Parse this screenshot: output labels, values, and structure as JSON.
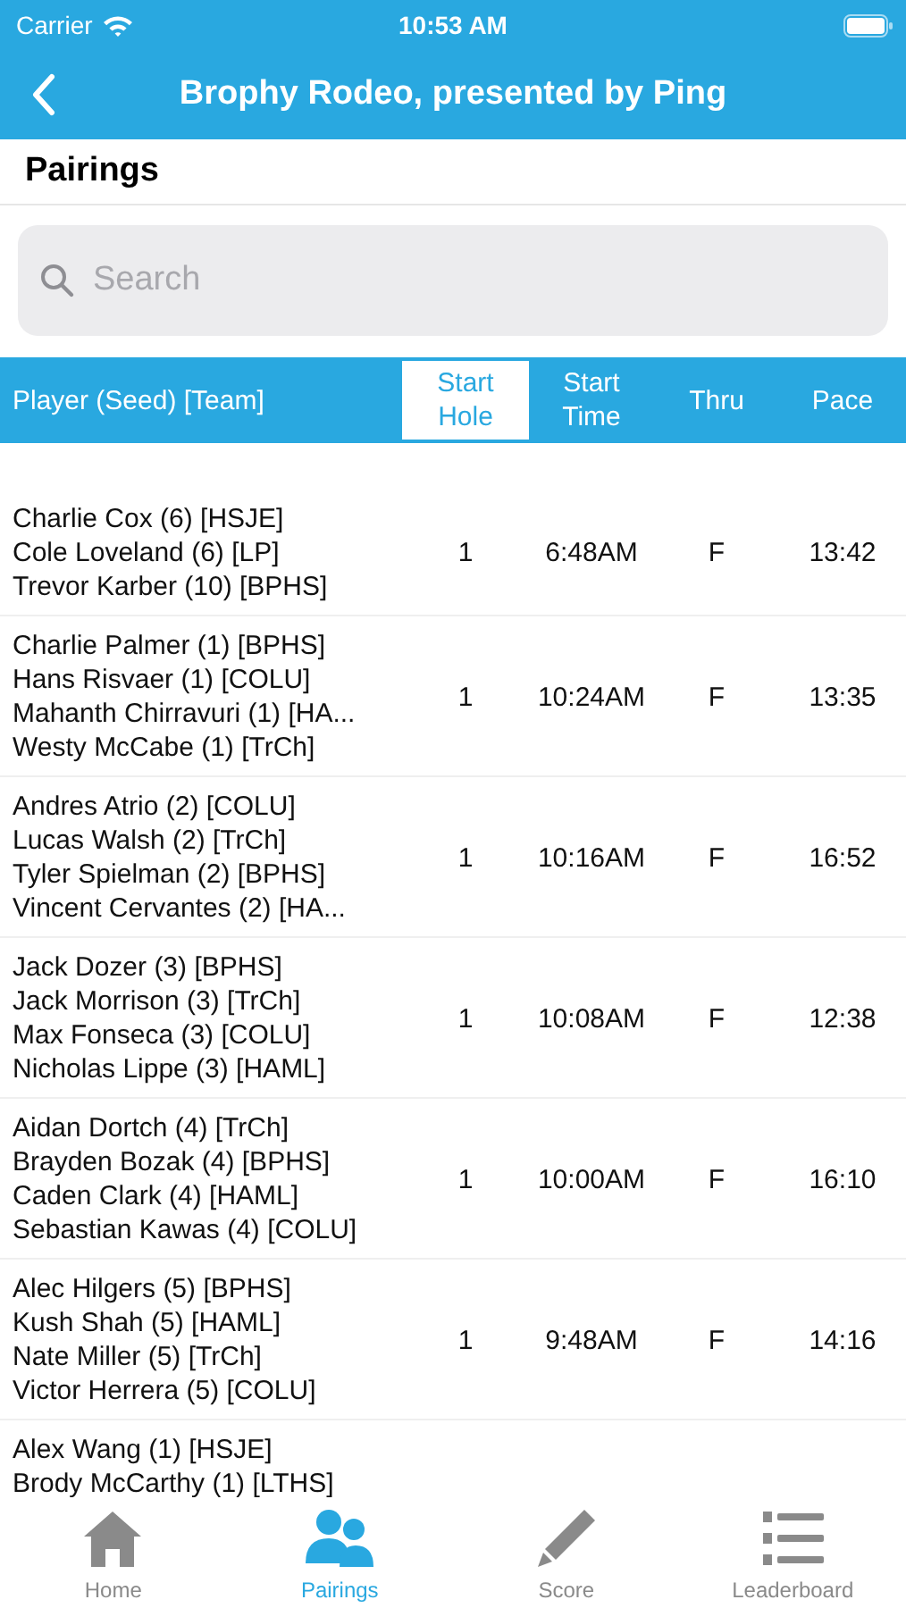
{
  "status_bar": {
    "carrier": "Carrier",
    "time": "10:53 AM"
  },
  "nav": {
    "title": "Brophy Rodeo, presented by Ping"
  },
  "section_title": "Pairings",
  "search": {
    "placeholder": "Search"
  },
  "columns": [
    {
      "label": "Player (Seed) [Team]",
      "selected": false
    },
    {
      "label": "Start Hole",
      "selected": true
    },
    {
      "label": "Start Time",
      "selected": false
    },
    {
      "label": "Thru",
      "selected": false
    },
    {
      "label": "Pace",
      "selected": false
    }
  ],
  "rows": [
    {
      "players": [
        "Charlie Cox (6) [HSJE]",
        "Cole  Loveland (6) [LP]",
        "Trevor Karber (10) [BPHS]"
      ],
      "start_hole": "1",
      "start_time": "6:48AM",
      "thru": "F",
      "pace": "13:42"
    },
    {
      "players": [
        "Charlie Palmer (1) [BPHS]",
        "Hans Risvaer (1) [COLU]",
        "Mahanth  Chirravuri (1) [HA...",
        "Westy McCabe (1) [TrCh]"
      ],
      "start_hole": "1",
      "start_time": "10:24AM",
      "thru": "F",
      "pace": "13:35"
    },
    {
      "players": [
        "Andres Atrio (2) [COLU]",
        "Lucas Walsh (2) [TrCh]",
        "Tyler Spielman (2) [BPHS]",
        "Vincent Cervantes (2) [HA..."
      ],
      "start_hole": "1",
      "start_time": "10:16AM",
      "thru": "F",
      "pace": "16:52"
    },
    {
      "players": [
        "Jack Dozer (3) [BPHS]",
        "Jack Morrison (3) [TrCh]",
        "Max Fonseca (3) [COLU]",
        "Nicholas Lippe (3) [HAML]"
      ],
      "start_hole": "1",
      "start_time": "10:08AM",
      "thru": "F",
      "pace": "12:38"
    },
    {
      "players": [
        "Aidan Dortch (4) [TrCh]",
        "Brayden Bozak (4) [BPHS]",
        "Caden Clark (4) [HAML]",
        "Sebastian  Kawas (4) [COLU]"
      ],
      "start_hole": "1",
      "start_time": "10:00AM",
      "thru": "F",
      "pace": "16:10"
    },
    {
      "players": [
        "Alec Hilgers (5) [BPHS]",
        "Kush Shah (5) [HAML]",
        "Nate Miller (5) [TrCh]",
        "Victor Herrera (5) [COLU]"
      ],
      "start_hole": "1",
      "start_time": "9:48AM",
      "thru": "F",
      "pace": "14:16"
    },
    {
      "players": [
        "Alex Wang (1) [HSJE]",
        "Brody McCarthy (1) [LTHS]"
      ]
    }
  ],
  "tabs": [
    {
      "label": "Home",
      "kind": "home",
      "selected": false
    },
    {
      "label": "Pairings",
      "kind": "people",
      "selected": true
    },
    {
      "label": "Score",
      "kind": "pencil",
      "selected": false
    },
    {
      "label": "Leaderboard",
      "kind": "list",
      "selected": false
    }
  ]
}
